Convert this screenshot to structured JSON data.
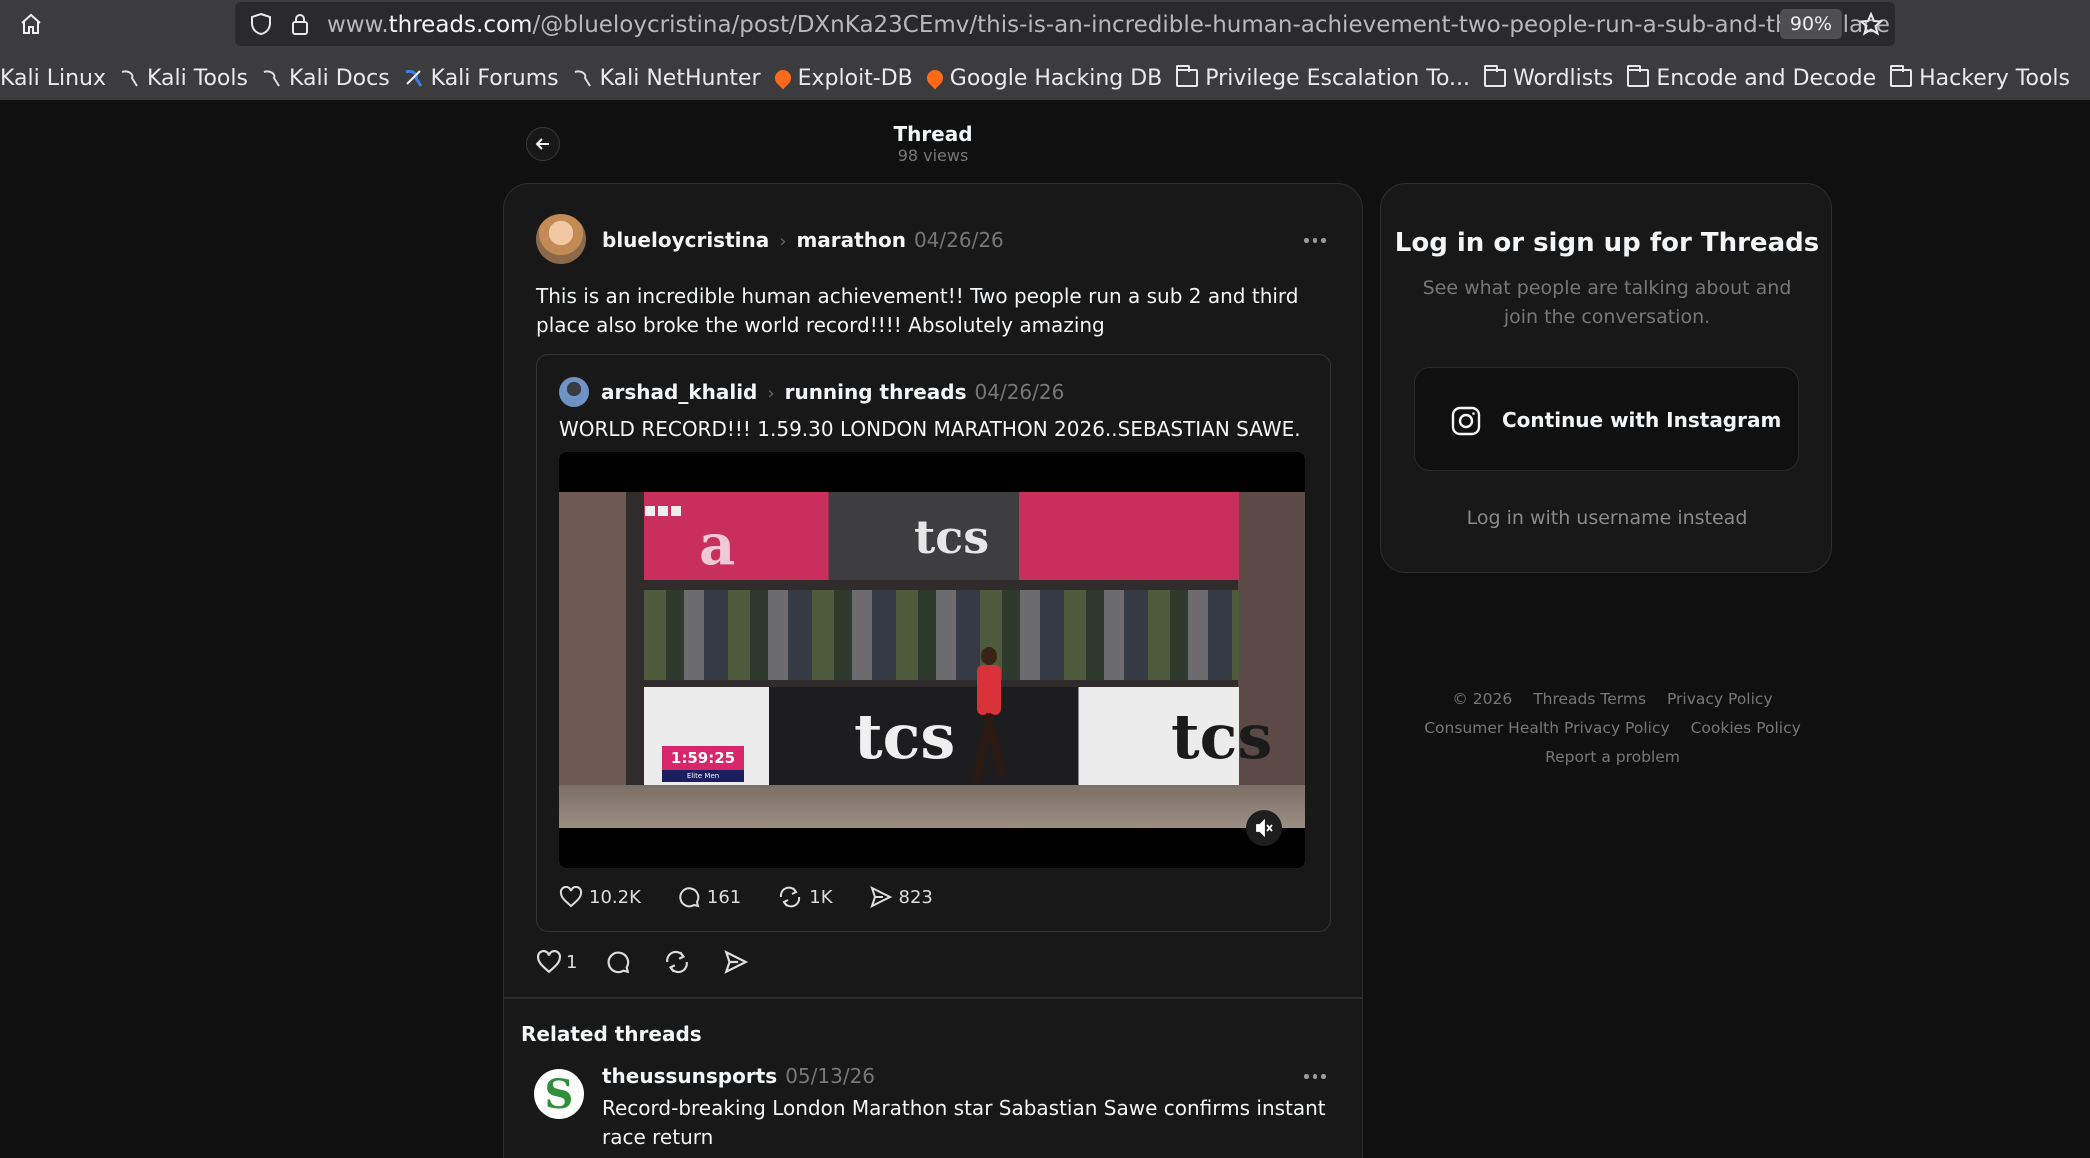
{
  "browser": {
    "url_prefix": "www.",
    "url_host": "threads.com",
    "url_path": "/@blueloycristina/post/DXnKa23CEmv/this-is-an-incredible-human-achievement-two-people-run-a-sub-and-third-place",
    "zoom": "90%",
    "bookmarks": [
      {
        "label": "Kali Linux",
        "icon": "none"
      },
      {
        "label": "Kali Tools",
        "icon": "kali-dragon-icon"
      },
      {
        "label": "Kali Docs",
        "icon": "kali-dragon-icon"
      },
      {
        "label": "Kali Forums",
        "icon": "kali-forums-icon"
      },
      {
        "label": "Kali NetHunter",
        "icon": "kali-dragon-icon"
      },
      {
        "label": "Exploit-DB",
        "icon": "exploit-db-icon"
      },
      {
        "label": "Google Hacking DB",
        "icon": "exploit-db-icon"
      },
      {
        "label": "Privilege Escalation To...",
        "icon": "folder-icon"
      },
      {
        "label": "Wordlists",
        "icon": "folder-icon"
      },
      {
        "label": "Encode and Decode",
        "icon": "folder-icon"
      },
      {
        "label": "Hackery Tools",
        "icon": "folder-icon"
      }
    ]
  },
  "header": {
    "title": "Thread",
    "views": "98 views"
  },
  "post": {
    "username": "blueloycristina",
    "topic": "marathon",
    "date": "04/26/26",
    "text": "This is an incredible human achievement!! Two people run a sub 2 and third place also broke the world record!!!! Absolutely amazing",
    "likes": "1",
    "quote": {
      "username": "arshad_khalid",
      "topic": "running threads",
      "date": "04/26/26",
      "text": "WORLD RECORD!!! 1.59.30 LONDON MARATHON 2026..SEBASTIAN SAWE.",
      "video": {
        "clock": "1:59:25",
        "clock_caption": "Elite Men",
        "logo_a": "a",
        "logo_tcs": "tcs"
      },
      "stats": {
        "likes": "10.2K",
        "replies": "161",
        "reposts": "1K",
        "shares": "823"
      }
    }
  },
  "related": {
    "title": "Related threads",
    "items": [
      {
        "username": "theussunsports",
        "date": "05/13/26",
        "avatar_letter": "S",
        "text": "Record-breaking London Marathon star Sabastian Sawe confirms instant race return"
      }
    ]
  },
  "login": {
    "title": "Log in or sign up for Threads",
    "subtitle": "See what people are talking about and join the conversation.",
    "instagram_button": "Continue with Instagram",
    "username_link": "Log in with username instead"
  },
  "footer": {
    "copyright": "© 2026",
    "terms": "Threads Terms",
    "privacy": "Privacy Policy",
    "health_privacy": "Consumer Health Privacy Policy",
    "cookies": "Cookies Policy",
    "report": "Report a problem"
  },
  "colors": {
    "background": "#101010",
    "card": "#181818",
    "border": "#2d2d2d",
    "text": "#f3f5f7",
    "muted": "#777777"
  }
}
